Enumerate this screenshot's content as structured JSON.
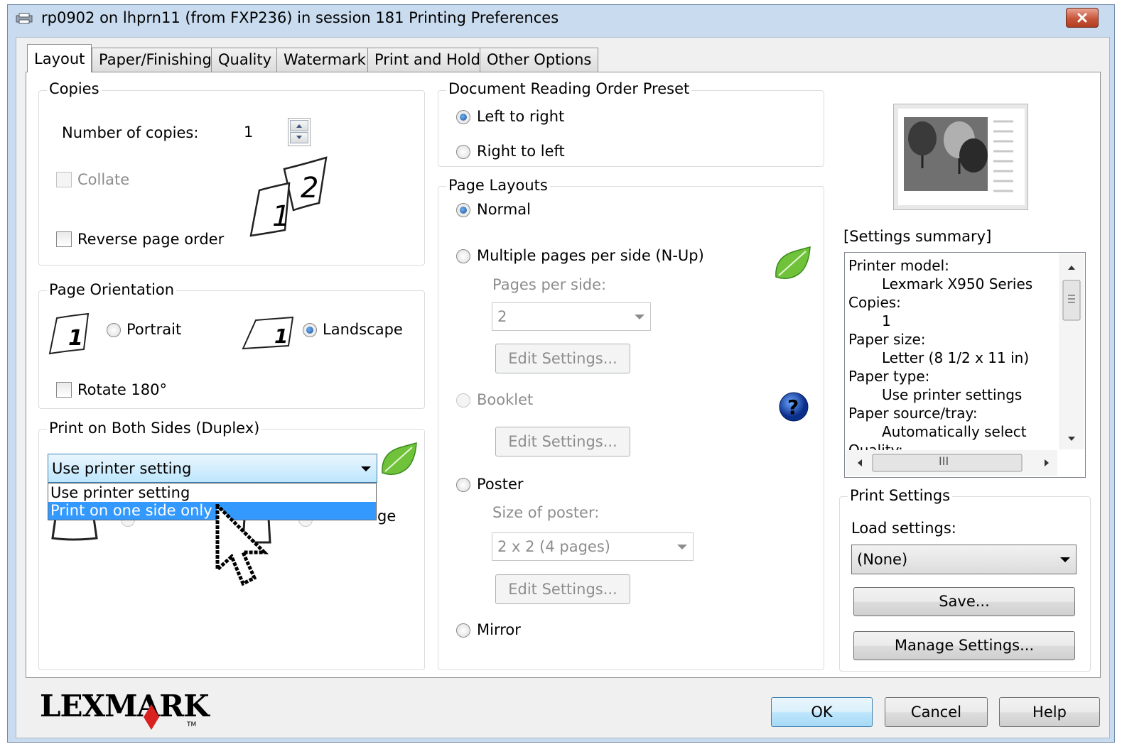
{
  "window": {
    "title": "rp0902 on lhprn11 (from FXP236) in session 181 Printing Preferences"
  },
  "tabs": [
    {
      "label": "Layout"
    },
    {
      "label": "Paper/Finishing"
    },
    {
      "label": "Quality"
    },
    {
      "label": "Watermark"
    },
    {
      "label": "Print and Hold"
    },
    {
      "label": "Other Options"
    }
  ],
  "copies": {
    "legend": "Copies",
    "number_label": "Number of copies:",
    "number_value": "1",
    "collate_label": "Collate",
    "reverse_label": "Reverse page order",
    "icon_page1": "1",
    "icon_page2": "2"
  },
  "orientation": {
    "legend": "Page Orientation",
    "portrait_label": "Portrait",
    "landscape_label": "Landscape",
    "rotate_label": "Rotate 180°",
    "icon_digit": "1",
    "selected": "Landscape"
  },
  "duplex": {
    "legend": "Print on Both Sides (Duplex)",
    "selected": "Use printer setting",
    "options": [
      "Use printer setting",
      "Print on one side only"
    ],
    "highlighted": "Print on one side only",
    "hidden_text_fragment": "ge"
  },
  "reading_order": {
    "legend": "Document Reading Order Preset",
    "left_to_right": "Left to right",
    "right_to_left": "Right to left",
    "selected": "Left to right"
  },
  "page_layouts": {
    "legend": "Page Layouts",
    "normal": "Normal",
    "nup": "Multiple pages per side (N-Up)",
    "pages_per_side_label": "Pages per side:",
    "pages_per_side_value": "2",
    "edit_settings": "Edit Settings...",
    "booklet": "Booklet",
    "poster": "Poster",
    "poster_size_label": "Size of poster:",
    "poster_size_value": "2 x 2 (4 pages)",
    "mirror": "Mirror",
    "selected": "Normal"
  },
  "summary": {
    "heading": "[Settings summary]",
    "lines": [
      {
        "text": "Printer model:",
        "indent": false
      },
      {
        "text": "Lexmark X950 Series",
        "indent": true
      },
      {
        "text": "Copies:",
        "indent": false
      },
      {
        "text": "1",
        "indent": true
      },
      {
        "text": "Paper size:",
        "indent": false
      },
      {
        "text": "Letter (8 1/2 x 11 in)",
        "indent": true
      },
      {
        "text": "Paper type:",
        "indent": false
      },
      {
        "text": "Use printer settings",
        "indent": true
      },
      {
        "text": "Paper source/tray:",
        "indent": false
      },
      {
        "text": "Automatically select",
        "indent": true
      },
      {
        "text": "Quality:",
        "indent": false
      }
    ],
    "hscroll_grip": "III"
  },
  "print_settings": {
    "legend": "Print Settings",
    "load_label": "Load settings:",
    "load_value": "(None)",
    "save_label": "Save...",
    "manage_label": "Manage Settings..."
  },
  "footer": {
    "logo_text": "LEXMARK",
    "logo_tm": "TM",
    "ok": "OK",
    "cancel": "Cancel",
    "help": "Help"
  },
  "colors": {
    "accent": "#3399ff",
    "title_bar": "#c9dbee",
    "logo_red": "#d9211f"
  }
}
